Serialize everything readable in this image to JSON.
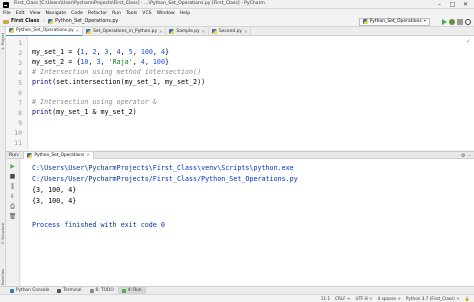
{
  "window": {
    "title": "First_Class [C:\\Users\\User\\PycharmProjects\\First_Class] - ...\\Python_Set_Operations.py [First_Class] - PyCharm",
    "controls": [
      "–",
      "□",
      "✕"
    ]
  },
  "menu": [
    "File",
    "Edit",
    "View",
    "Navigate",
    "Code",
    "Refactor",
    "Run",
    "Tools",
    "VCS",
    "Window",
    "Help"
  ],
  "nav": {
    "breadcrumb_project": "First Class",
    "breadcrumb_file": "Python_Set_Operations.py",
    "run_config": "Python_Set_Operations"
  },
  "tabs": [
    {
      "label": "Python_Set_Operations.py",
      "active": true
    },
    {
      "label": "Set_Operations_in_Python.py",
      "active": false
    },
    {
      "label": "Sample.py",
      "active": false
    },
    {
      "label": "Second.py",
      "active": false
    }
  ],
  "editor": {
    "line_numbers": [
      "1",
      "2",
      "3",
      "4",
      "5",
      "6",
      "7",
      "8",
      "9",
      "10",
      "11"
    ],
    "lines": {
      "l1_var": "my_set_1",
      "l1_eq": " = ",
      "l1_open": "{",
      "l1_nums": [
        "1",
        "2",
        "3",
        "4",
        "5",
        "100",
        "4"
      ],
      "l1_close": "}",
      "l2_var": "my_set_2",
      "l2_eq": " = ",
      "l2_open": "{",
      "l2_n1": "10",
      "l2_n2": "3",
      "l2_str": "'Raja'",
      "l2_n3": "4",
      "l2_n4": "100",
      "l2_close": "}",
      "l3": "# Intersection using method intersection()",
      "l4_fn": "print",
      "l4_rest": "(set.intersection(my_set_1, my_set_2))",
      "l5": "# Intersection using operator &",
      "l6_fn": "print",
      "l6_rest": "(my_set_1 & my_set_2)"
    }
  },
  "run_panel": {
    "label": "Run:",
    "tab": "Python_Set_Operations",
    "output": [
      "C:\\Users\\User\\PycharmProjects\\First_Class\\venv\\Scripts\\python.exe",
      "C:/Users/User/PycharmProjects/First_Class/Python_Set_Operations.py",
      "{3, 100, 4}",
      "{3, 100, 4}",
      "",
      "Process finished with exit code 0"
    ]
  },
  "tool_windows": [
    {
      "label": "Python Console",
      "icon_color": "#3b77a8"
    },
    {
      "label": "Terminal",
      "icon_color": "#555555"
    },
    {
      "label": "6: TODO",
      "icon_color": "#888888"
    },
    {
      "label": "4: Run",
      "icon_color": "#4caf50"
    }
  ],
  "left_strip": [
    "1: Project",
    "7: Structure",
    "2: Favorites"
  ],
  "status_bar": {
    "position": "11:1",
    "line_sep": "CRLF ÷",
    "encoding": "UTF-8 ÷",
    "indent": "4 spaces ÷",
    "interpreter": "Python 3.7 (First_Class) ÷"
  },
  "colors": {
    "number": "#1750eb",
    "string": "#067d17",
    "comment": "#8c8c8c",
    "path": "#0033b3"
  }
}
